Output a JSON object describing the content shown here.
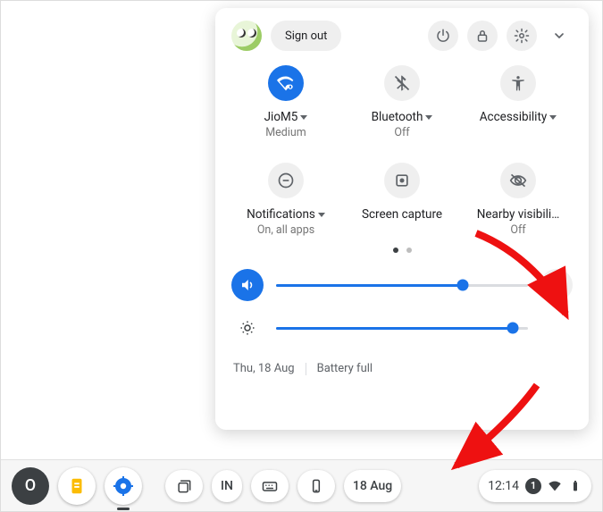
{
  "header": {
    "sign_out": "Sign out"
  },
  "tiles": {
    "wifi": {
      "label": "JioM5",
      "sub": "Medium",
      "has_menu": true
    },
    "bluetooth": {
      "label": "Bluetooth",
      "sub": "Off",
      "has_menu": true
    },
    "accessibility": {
      "label": "Accessibility",
      "sub": "",
      "has_menu": true
    },
    "notifications": {
      "label": "Notifications",
      "sub": "On, all apps",
      "has_menu": true
    },
    "screencap": {
      "label": "Screen capture",
      "sub": ""
    },
    "nearby": {
      "label": "Nearby visibili…",
      "sub": "Off"
    }
  },
  "sliders": {
    "volume": {
      "value": 74
    },
    "brightness": {
      "value": 94
    }
  },
  "footer": {
    "date": "Thu, 18 Aug",
    "battery": "Battery full"
  },
  "shelf": {
    "launcher_letter": "O",
    "ime": "IN",
    "date_badge": "18 Aug",
    "time": "12:14",
    "notification_count": "1"
  }
}
